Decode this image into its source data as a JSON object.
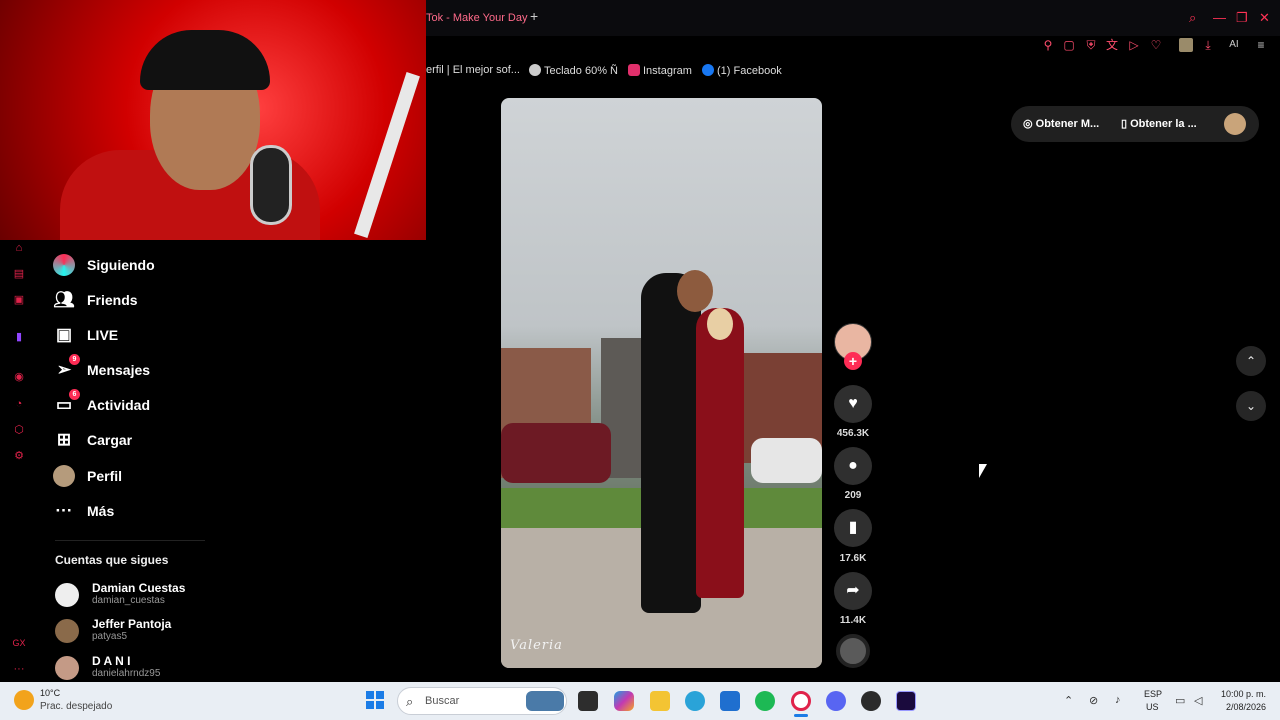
{
  "browser": {
    "tab_title": "Tok - Make Your Day",
    "new_tab_symbol": "+",
    "toolbar_ai_label": "AI",
    "bookmarks": [
      {
        "label": "erfil | El mejor sof...",
        "color": "#888888"
      },
      {
        "label": "Teclado 60% Ñ",
        "color": "#cccccc"
      },
      {
        "label": "Instagram",
        "color": "#e1306c"
      },
      {
        "label": "(1) Facebook",
        "color": "#1877f2"
      }
    ]
  },
  "nav": {
    "items": [
      {
        "label": "Siguiendo",
        "icon": "following-icon"
      },
      {
        "label": "Friends",
        "icon": "friends-icon"
      },
      {
        "label": "LIVE",
        "icon": "live-icon"
      },
      {
        "label": "Mensajes",
        "icon": "messages-icon",
        "badge": "9"
      },
      {
        "label": "Actividad",
        "icon": "activity-icon",
        "badge": "6"
      },
      {
        "label": "Cargar",
        "icon": "upload-icon"
      },
      {
        "label": "Perfil",
        "icon": "profile-avatar"
      },
      {
        "label": "Más",
        "icon": "more-icon"
      }
    ]
  },
  "following": {
    "title": "Cuentas que sigues",
    "accounts": [
      {
        "name": "Damian Cuestas",
        "handle": "damian_cuestas"
      },
      {
        "name": "Jeffer Pantoja",
        "handle": "patyas5"
      },
      {
        "name": "D A N I",
        "handle": "danielahrndz95"
      }
    ]
  },
  "video": {
    "watermark": "Valeria",
    "likes": "456.3K",
    "comments": "209",
    "saves": "17.6K",
    "shares": "11.4K"
  },
  "get_app": {
    "left_label": "Obtener M...",
    "right_label": "Obtener la ..."
  },
  "taskbar": {
    "temperature": "10°C",
    "weather": "Prac. despejado",
    "search_placeholder": "Buscar",
    "lang": "ESP",
    "region": "US",
    "time": "10:00 p. m.",
    "date": "2/08/2026"
  }
}
